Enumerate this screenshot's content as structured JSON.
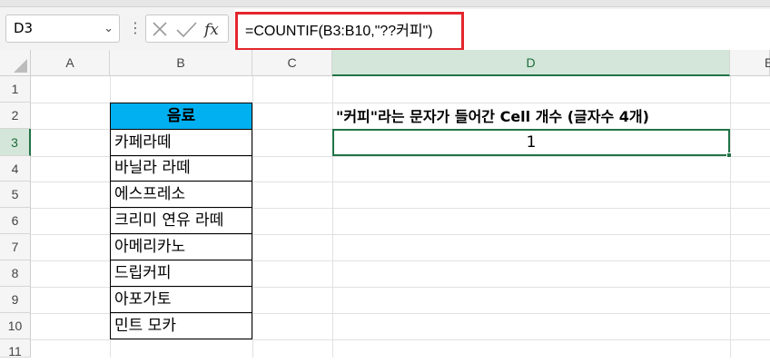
{
  "name_box": {
    "value": "D3",
    "chevron": "⌄"
  },
  "formula_bar": {
    "formula": "=COUNTIF(B3:B10,\"??커피\")",
    "icons": [
      "more-dots-icon",
      "cancel-x-icon",
      "enter-check-icon",
      "fx-icon"
    ],
    "fx_label": "fx"
  },
  "columns": [
    "A",
    "B",
    "C",
    "D",
    "E"
  ],
  "selected_column": "D",
  "rows": [
    "1",
    "2",
    "3",
    "4",
    "5",
    "6",
    "7",
    "8",
    "9",
    "10",
    "11"
  ],
  "selected_row": "3",
  "table": {
    "header": "음료",
    "items": [
      "카페라떼",
      "바닐라 라떼",
      "에스프레소",
      "크리미 연유 라떼",
      "아메리카노",
      "드립커피",
      "아포가토",
      "민트 모카"
    ]
  },
  "d2_label": "\"커피\"라는 문자가 들어간 Cell 개수 (글자수 4개)",
  "d3_result": "1",
  "colors": {
    "selection": "#217346",
    "header_fill": "#00b0f0",
    "highlight_border": "#e3262d"
  }
}
